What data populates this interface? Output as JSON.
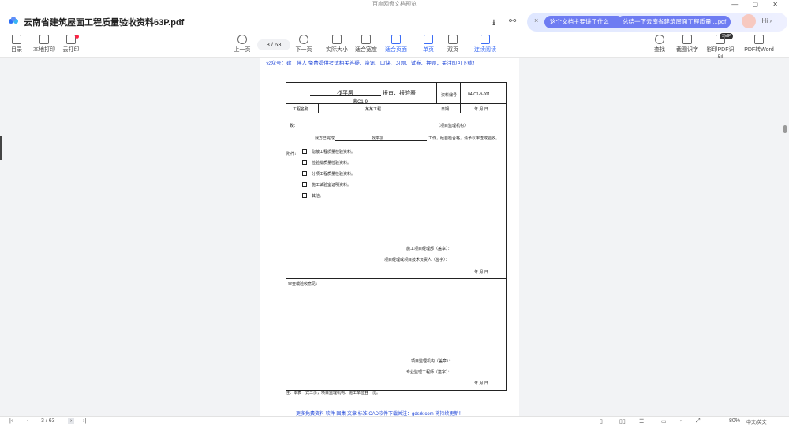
{
  "window": {
    "title": "百度网盘文档预览",
    "controls": "— ▢ ✕"
  },
  "header": {
    "doc_title": "云南省建筑屋面工程质量验收资料63P.pdf",
    "download_icon": "download-icon",
    "share_icon": "share-icon"
  },
  "ai": {
    "close": "×",
    "chip1": "这个文档主要讲了什么",
    "chip2": "总结一下云南省建筑屋面工程质量....pdf",
    "hi": "Hi ›"
  },
  "toolbar": {
    "catalog": "目录",
    "local_print": "本地打印",
    "cloud_print": "云打印",
    "prev": "上一页",
    "page_indicator": "3 / 63",
    "next": "下一页",
    "actual_size": "实际大小",
    "fit_width": "适合宽度",
    "fit_page": "适合页面",
    "single": "单页",
    "double": "双页",
    "continuous": "连续阅读",
    "find": "查找",
    "ocr": "截图识字",
    "scan_ocr": "影印PDF识别",
    "svip": "SVIP",
    "pdf_word": "PDF转Word"
  },
  "document": {
    "gzh": "公众号：建工伴人 免费提供考试相关答疑、资讯、口诀、习题、试卷、押题，关注即可下载！",
    "form_title": "找平层",
    "form_title2": "报审、报验表",
    "form_code": "表C1-9",
    "no_label": "资料编号",
    "no_value": "04-C1-9-001",
    "project_label": "工程名称",
    "project_value": "某某工程",
    "date_label": "日期",
    "to": "致：",
    "to_suffix": "（项目监理机构）",
    "we_done": "我方已完成",
    "we_done_item": "找平层",
    "we_done_suffix": "工作，经自检合格，请予以审查或验收。",
    "attach": "附件：",
    "checks": [
      "隐蔽工程质量检验资料。",
      "检验批质量检验资料。",
      "分项工程质量检验资料。",
      "施工试验室证明资料。",
      "其他。"
    ],
    "sign1": "施工项目经理部（盖章）：",
    "sign2": "项目经理或项目技术负责人（签字）：",
    "ymd": "年   月   日",
    "review": "审查或验收意见：",
    "sign3": "项目监理机构（盖章）：",
    "sign4": "专业监理工程师（签字）：",
    "note": "注：本表一式二份，项目监理机构、施工单位各一份。",
    "bottom_note": "更多免费资料 软件 图集 文章 标准 CAD软件下载关注：gdsrk.com 将持续更新！"
  },
  "status": {
    "page": "3 / 63",
    "zoom": "80%",
    "watermark": "中文/英文"
  }
}
